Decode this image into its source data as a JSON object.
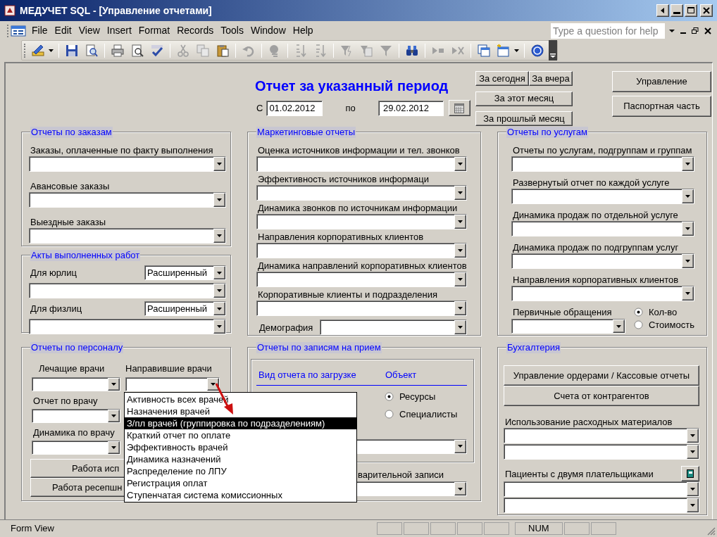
{
  "window": {
    "title": "МЕДУЧЕТ SQL - [Управление отчетами]"
  },
  "menu": [
    "File",
    "Edit",
    "View",
    "Insert",
    "Format",
    "Records",
    "Tools",
    "Window",
    "Help"
  ],
  "help_box": {
    "placeholder": "Type a question for help"
  },
  "form": {
    "title": "Отчет за указанный период",
    "period": {
      "from_label": "С",
      "from": "01.02.2012",
      "to_label": "по",
      "to": "29.02.2012"
    },
    "quick_buttons": [
      "За сегодня",
      "За вчера",
      "За этот месяц",
      "За прошлый месяц"
    ],
    "side_buttons": [
      "Управление",
      "Паспортная часть"
    ],
    "orders": {
      "legend": "Отчеты по заказам",
      "items": [
        {
          "kind": "label",
          "text": "Заказы, оплаченные по факту выполнения"
        },
        {
          "kind": "combo"
        },
        {
          "kind": "label",
          "text": "Авансовые заказы"
        },
        {
          "kind": "combo"
        },
        {
          "kind": "label",
          "text": "Выездные заказы"
        },
        {
          "kind": "combo"
        }
      ]
    },
    "acts": {
      "legend": "Акты выполненных работ",
      "items": [
        {
          "kind": "label_combo",
          "text": "Для юрлиц",
          "value": "Расширенный"
        },
        {
          "kind": "combo"
        },
        {
          "kind": "label_combo",
          "text": "Для физлиц",
          "value": "Расширенный"
        },
        {
          "kind": "combo"
        }
      ]
    },
    "staff": {
      "legend": "Отчеты по персоналу",
      "treating_label": "Лечащие врачи",
      "referring_label": "Направившие врачи",
      "doctor_label": "Отчет по врачу",
      "dynamics_label": "Динамика по врачу",
      "buttons": [
        "Работа исп",
        "Работа ресепшн"
      ],
      "dropdown": [
        {
          "text": "Активность всех врачей",
          "selected": false
        },
        {
          "text": "Назначения врачей",
          "selected": false
        },
        {
          "text": "З/пл врачей (группировка по подразделениям)",
          "selected": true
        },
        {
          "text": "Краткий отчет по оплате",
          "selected": false
        },
        {
          "text": "Эффективность врачей",
          "selected": false
        },
        {
          "text": "Динамика назначений",
          "selected": false
        },
        {
          "text": "Распределение по ЛПУ",
          "selected": false
        },
        {
          "text": "Регистрация оплат",
          "selected": false
        },
        {
          "text": "Ступенчатая система комиссионных",
          "selected": false
        }
      ]
    },
    "marketing": {
      "legend": "Маркетинговые отчеты",
      "items": [
        {
          "kind": "label",
          "text": "Оценка источников информации и тел. звонков"
        },
        {
          "kind": "combo"
        },
        {
          "kind": "label",
          "text": "Эффективность источников информаци"
        },
        {
          "kind": "combo"
        },
        {
          "kind": "label",
          "text": "Динамика звонков по источникам информации"
        },
        {
          "kind": "combo"
        },
        {
          "kind": "label",
          "text": "Направления корпоративных клиентов"
        },
        {
          "kind": "combo"
        },
        {
          "kind": "label",
          "text": "Динамика направлений корпоративных клиентов"
        },
        {
          "kind": "combo"
        },
        {
          "kind": "label",
          "text": "Корпоративные клиенты и подразделения"
        },
        {
          "kind": "combo"
        },
        {
          "kind": "label_wide_combo",
          "text": "Демография"
        }
      ]
    },
    "appointments": {
      "legend": "Отчеты по записям на прием",
      "report_type_heading": "Вид отчета по загрузке",
      "object_heading": "Объект",
      "object_options": [
        {
          "label": "Ресурсы",
          "selected": true
        },
        {
          "label": "Специалисты",
          "selected": false
        }
      ],
      "label": "варительной записи"
    },
    "services": {
      "legend": "Отчеты по услугам",
      "items": [
        {
          "kind": "label",
          "text": "Отчеты по услугам, подгруппам и группам"
        },
        {
          "kind": "combo"
        },
        {
          "kind": "label",
          "text": "Развернутый отчет по каждой услуге"
        },
        {
          "kind": "combo"
        },
        {
          "kind": "label",
          "text": "Динамика продаж по отдельной услуге"
        },
        {
          "kind": "combo"
        },
        {
          "kind": "label",
          "text": "Динамика продаж по подгруппам услуг"
        },
        {
          "kind": "combo"
        },
        {
          "kind": "label",
          "text": "Направления корпоративных клиентов"
        },
        {
          "kind": "combo"
        },
        {
          "kind": "combo_radios",
          "text": "Первичные обращения",
          "options": [
            {
              "label": "Кол-во",
              "selected": true
            },
            {
              "label": "Стоимость",
              "selected": false
            }
          ]
        }
      ]
    },
    "accounting": {
      "legend": "Бухгалтерия",
      "items": [
        {
          "kind": "button",
          "text": "Управление ордерами / Кассовые отчеты"
        },
        {
          "kind": "button",
          "text": "Счета от контрагентов"
        },
        {
          "kind": "label",
          "text": "Использование расходных материалов"
        },
        {
          "kind": "combo"
        },
        {
          "kind": "combo"
        },
        {
          "kind": "label_button",
          "text": "Пациенты с двумя плательщиками"
        },
        {
          "kind": "combo"
        },
        {
          "kind": "combo"
        }
      ]
    }
  },
  "status_bar": {
    "mode": "Form View",
    "indicator": "NUM"
  }
}
